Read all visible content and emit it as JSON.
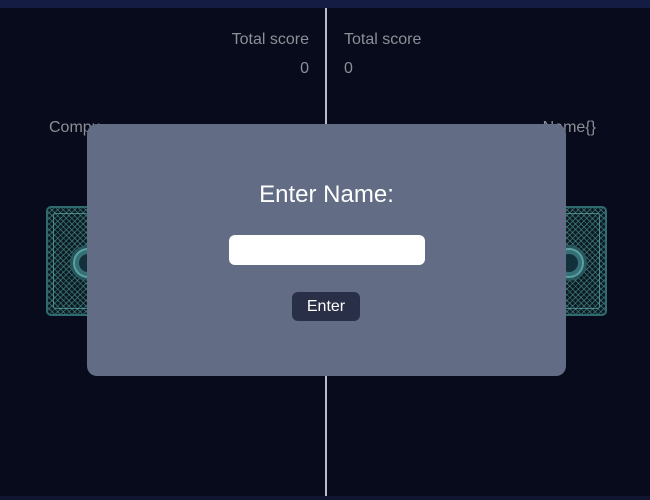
{
  "scoreboard": {
    "left": {
      "label": "Total score",
      "value": "0",
      "player": "Compu"
    },
    "right": {
      "label": "Total score",
      "value": "0",
      "player": "Name{}"
    }
  },
  "modal": {
    "title": "Enter Name:",
    "input_value": "",
    "input_placeholder": "",
    "button_label": "Enter"
  },
  "colors": {
    "background": "#080b1b",
    "top_bar": "#141c44",
    "modal": "#626c85",
    "button": "#2a2f48",
    "card_pattern": "#2f6b6e"
  },
  "icons": {
    "card_back": "card-back-icon"
  }
}
